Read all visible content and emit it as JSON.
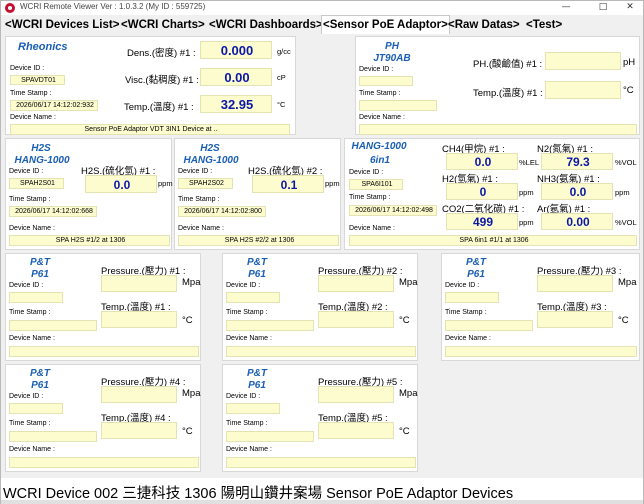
{
  "window": {
    "title": "WCRI Remote Viewer Ver : 1.0.3.2 (My ID : 559725)",
    "controls": {
      "minimize": "—",
      "maximize": "□",
      "close": "✕"
    }
  },
  "tabs": [
    {
      "label": "<WCRI Devices List>",
      "active": false
    },
    {
      "label": "<WCRI Charts>",
      "active": false
    },
    {
      "label": "<WCRI Dashboards>",
      "active": false
    },
    {
      "label": "<Sensor PoE Adaptor>",
      "active": true
    },
    {
      "label": "<Raw Datas>",
      "active": false
    },
    {
      "label": "<Test>",
      "active": false
    }
  ],
  "common": {
    "device_id_label": "Device ID :",
    "time_stamp_label": "Time Stamp :",
    "device_name_label": "Device Name :"
  },
  "rheonics": {
    "brand": "Rheonics",
    "device_id": "SPAVDT01",
    "time_stamp": "2026/06/17 14:12:02:932",
    "device_name": "Sensor PoE Adaptor VDT 3IN1 Device at ..",
    "dens": {
      "label": "Dens.(密度) #1 :",
      "value": "0.000",
      "unit": "g/cc"
    },
    "visc": {
      "label": "Visc.(黏稠度) #1 :",
      "value": "0.00",
      "unit": "cP"
    },
    "temp": {
      "label": "Temp.(溫度) #1 :",
      "value": "32.95",
      "unit": "°C"
    }
  },
  "ph": {
    "brand_line1": "PH",
    "brand_line2": "JT90AB",
    "ph_label": "PH.(酸鹼值) #1 :",
    "ph_unit": "pH",
    "temp_label": "Temp.(溫度) #1 :",
    "temp_unit": "°C"
  },
  "h2s1": {
    "brand_line1": "H2S",
    "brand_line2": "HANG-1000",
    "label": "H2S.(硫化氫) #1 :",
    "value": "0.0",
    "unit": "ppm",
    "device_id": "SPAH2S01",
    "time_stamp": "2026/06/17 14:12:02:668",
    "device_name": "SPA H2S #1/2 at 1306"
  },
  "h2s2": {
    "brand_line1": "H2S",
    "brand_line2": "HANG-1000",
    "label": "H2S.(硫化氫) #2 :",
    "value": "0.1",
    "unit": "ppm",
    "device_id": "SPAH2S02",
    "time_stamp": "2026/06/17 14:12:02:800",
    "device_name": "SPA H2S #2/2 at 1306"
  },
  "sixin1": {
    "brand_line1": "HANG-1000",
    "brand_line2": "6in1",
    "device_id": "SPA6I101",
    "time_stamp": "2026/06/17 14:12:02:498",
    "device_name": "SPA 6in1 #1/1 at 1306",
    "ch4": {
      "label": "CH4(甲烷) #1 :",
      "value": "0.0",
      "unit": "%LEL"
    },
    "h2": {
      "label": "H2(氫氣) #1 :",
      "value": "0",
      "unit": "ppm"
    },
    "co2": {
      "label": "CO2(二氧化碳) #1 :",
      "value": "499",
      "unit": "ppm"
    },
    "n2": {
      "label": "N2(氮氣) #1 :",
      "value": "79.3",
      "unit": "%VOL"
    },
    "nh3": {
      "label": "NH3(氨氣) #1 :",
      "value": "0.0",
      "unit": "ppm"
    },
    "ar": {
      "label": "Ar(氬氣) #1 :",
      "value": "0.00",
      "unit": "%VOL"
    }
  },
  "pt": [
    {
      "brand_line1": "P&T",
      "brand_line2": "P61",
      "pressure_label": "Pressure.(壓力) #1 :",
      "pressure_unit": "Mpa",
      "temp_label": "Temp.(溫度) #1 :",
      "temp_unit": "°C"
    },
    {
      "brand_line1": "P&T",
      "brand_line2": "P61",
      "pressure_label": "Pressure.(壓力) #2 :",
      "pressure_unit": "Mpa",
      "temp_label": "Temp.(溫度) #2 :",
      "temp_unit": "°C"
    },
    {
      "brand_line1": "P&T",
      "brand_line2": "P61",
      "pressure_label": "Pressure.(壓力) #3 :",
      "pressure_unit": "Mpa",
      "temp_label": "Temp.(溫度) #3 :",
      "temp_unit": "°C"
    },
    {
      "brand_line1": "P&T",
      "brand_line2": "P61",
      "pressure_label": "Pressure.(壓力) #4 :",
      "pressure_unit": "Mpa",
      "temp_label": "Temp.(溫度) #4 :",
      "temp_unit": "°C"
    },
    {
      "brand_line1": "P&T",
      "brand_line2": "P61",
      "pressure_label": "Pressure.(壓力) #5 :",
      "pressure_unit": "Mpa",
      "temp_label": "Temp.(溫度) #5 :",
      "temp_unit": "°C"
    }
  ],
  "status": {
    "text": "WCRI Device 002 三捷科技 1306 陽明山鑽井案場 Sensor PoE Adaptor Devices"
  }
}
